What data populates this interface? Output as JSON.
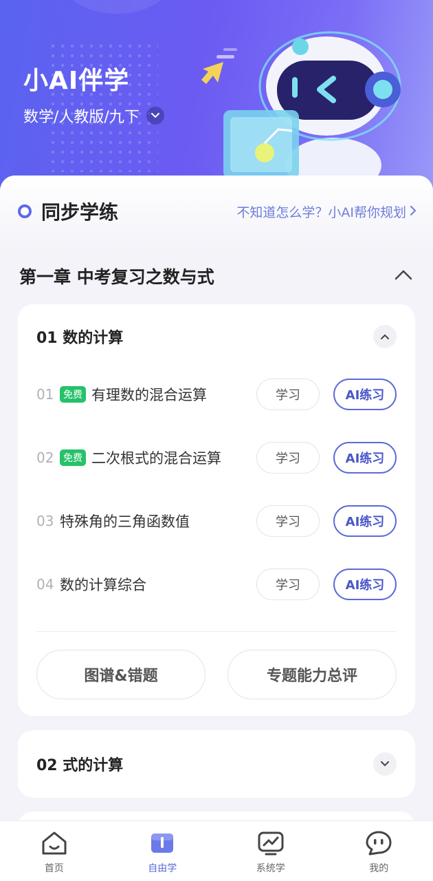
{
  "header": {
    "app_title": "小AI伴学",
    "subject": "数学/人教版/九下"
  },
  "sync": {
    "title": "同步学练",
    "help_link": "不知道怎么学？小AI帮你规划"
  },
  "chapter": {
    "title": "第一章 中考复习之数与式"
  },
  "sections": [
    {
      "title": "01 数的计算",
      "expanded": true,
      "lessons": [
        {
          "num": "01",
          "free_badge": "免费",
          "name": "有理数的混合运算",
          "study_label": "学习",
          "ai_label": "AI练习"
        },
        {
          "num": "02",
          "free_badge": "免费",
          "name": "二次根式的混合运算",
          "study_label": "学习",
          "ai_label": "AI练习"
        },
        {
          "num": "03",
          "name": "特殊角的三角函数值",
          "study_label": "学习",
          "ai_label": "AI练习"
        },
        {
          "num": "04",
          "name": "数的计算综合",
          "study_label": "学习",
          "ai_label": "AI练习"
        }
      ],
      "actions": [
        "图谱&错题",
        "专题能力总评"
      ]
    },
    {
      "title": "02 式的计算",
      "expanded": false
    }
  ],
  "nav": {
    "items": [
      {
        "label": "首页",
        "icon": "home-icon"
      },
      {
        "label": "自由学",
        "icon": "book-icon",
        "active": true
      },
      {
        "label": "系统学",
        "icon": "chart-icon"
      },
      {
        "label": "我的",
        "icon": "chat-face-icon"
      }
    ]
  },
  "colors": {
    "accent": "#5b6ad8",
    "free_badge": "#26c26a",
    "header_gradient_start": "#5a63f0",
    "header_gradient_end": "#9a9af8"
  }
}
